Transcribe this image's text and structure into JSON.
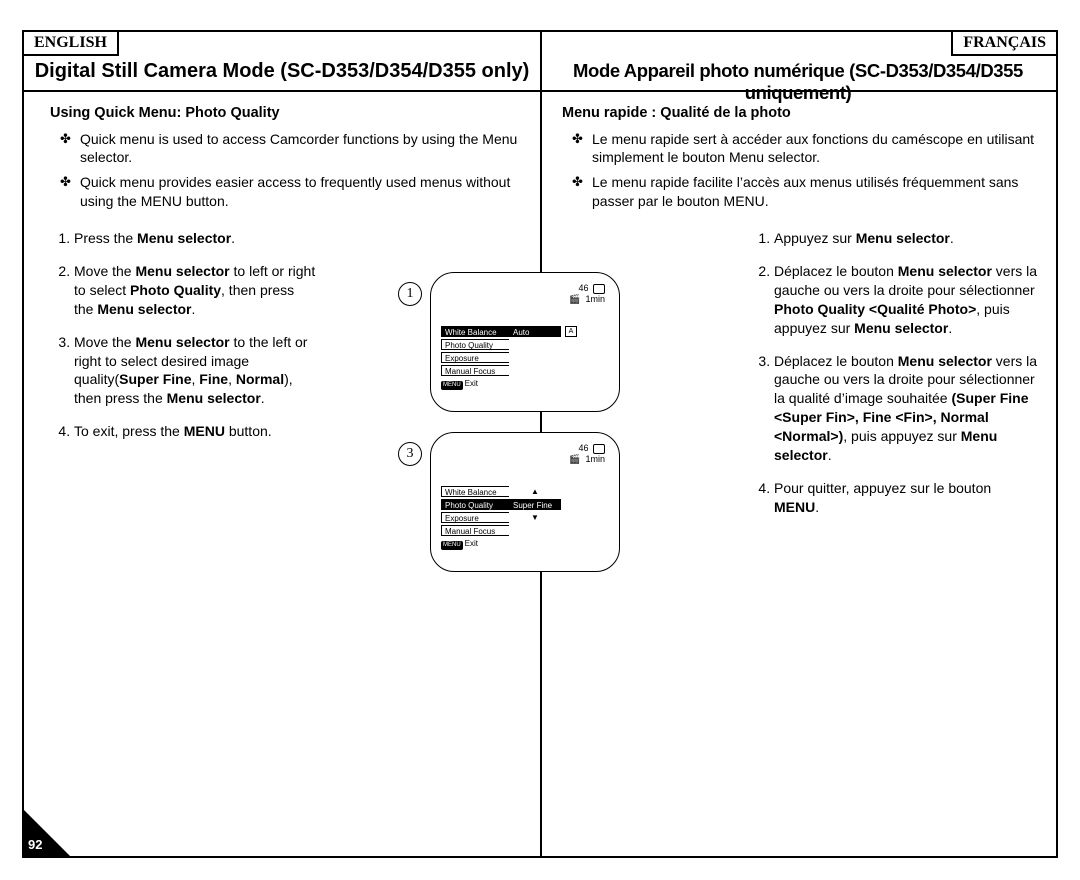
{
  "lang": {
    "en": "ENGLISH",
    "fr": "FRANÇAIS"
  },
  "title": {
    "en": "Digital Still Camera Mode (SC-D353/D354/D355 only)",
    "fr": "Mode Appareil photo numérique (SC-D353/D354/D355 uniquement)"
  },
  "subtitle": {
    "en": "Using Quick Menu: Photo Quality",
    "fr": "Menu rapide : Qualité de la photo"
  },
  "bullets": {
    "en": [
      "Quick menu is used to access Camcorder functions by using the Menu selector.",
      "Quick menu provides easier access to frequently used menus without using the MENU button."
    ],
    "fr": [
      "Le menu rapide sert à accéder aux fonctions du caméscope en utilisant simplement le bouton Menu selector.",
      "Le menu rapide facilite l’accès aux menus utilisés fréquemment sans passer par le bouton MENU."
    ]
  },
  "steps_en": {
    "s1a": "Press the ",
    "s1b": "Menu selector",
    "s1c": ".",
    "s2a": "Move the ",
    "s2b": "Menu selector",
    "s2c": " to left or right to select ",
    "s2d": "Photo Quality",
    "s2e": ", then press the ",
    "s2f": "Menu selector",
    "s2g": ".",
    "s3a": "Move the ",
    "s3b": "Menu selector",
    "s3c": " to the left or right to select desired image quality(",
    "s3d": "Super Fine",
    "s3e": ", ",
    "s3f": "Fine",
    "s3g": ", ",
    "s3h": "Normal",
    "s3i": "), then press the ",
    "s3j": "Menu selector",
    "s3k": ".",
    "s4a": "To exit, press the ",
    "s4b": "MENU",
    "s4c": " button."
  },
  "steps_fr": {
    "s1a": "Appuyez sur ",
    "s1b": "Menu selector",
    "s1c": ".",
    "s2a": "Déplacez le bouton ",
    "s2b": "Menu selector",
    "s2c": " vers la gauche ou vers la droite pour sélectionner ",
    "s2d": "Photo Quality <Qualité Photo>",
    "s2e": ", puis appuyez sur ",
    "s2f": "Menu selector",
    "s2g": ".",
    "s3a": "Déplacez le bouton ",
    "s3b": "Menu selector",
    "s3c": " vers la gauche ou vers la droite pour sélectionner la qualité d’image souhaitée ",
    "s3d": "(Super Fine <Super Fin>, Fine <Fin>, Normal <Normal>)",
    "s3e": ", puis appuyez sur ",
    "s3f": "Menu selector",
    "s3g": ".",
    "s4a": "Pour quitter, appuyez sur le bouton ",
    "s4b": "MENU",
    "s4c": "."
  },
  "dia": {
    "num1": "1",
    "num3": "3",
    "count": "46",
    "time": "1min",
    "wb": "White Balance",
    "pq": "Photo Quality",
    "ex": "Exposure",
    "mf": "Manual Focus",
    "auto": "Auto",
    "sfine": "Super Fine",
    "a": "A",
    "menu": "MENU",
    "exit": "Exit"
  },
  "page_number": "92"
}
